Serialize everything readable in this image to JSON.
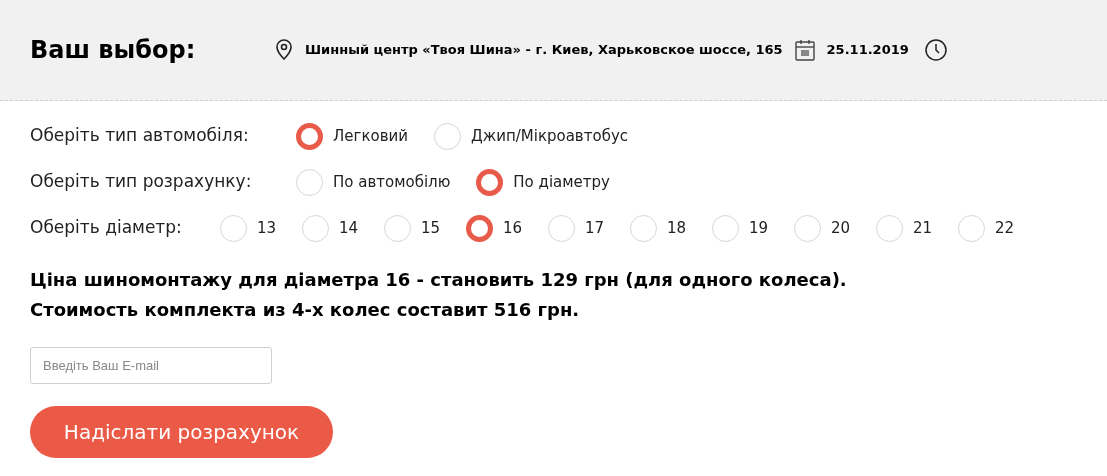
{
  "header": {
    "title": "Ваш выбор:",
    "location": "Шинный центр «Твоя Шина» - г. Киев, Харьковское шоссе, 165",
    "date": "25.11.2019"
  },
  "groups": [
    {
      "label": "Оберіть тип автомобіля:",
      "options": [
        {
          "label": "Легковий",
          "selected": true
        },
        {
          "label": "Джип/Мікроавтобус",
          "selected": false
        }
      ]
    },
    {
      "label": "Оберіть тип розрахунку:",
      "options": [
        {
          "label": "По автомобілю",
          "selected": false
        },
        {
          "label": "По діаметру",
          "selected": true
        }
      ]
    },
    {
      "label": "Оберіть діаметр:",
      "options": [
        {
          "label": "13",
          "selected": false
        },
        {
          "label": "14",
          "selected": false
        },
        {
          "label": "15",
          "selected": false
        },
        {
          "label": "16",
          "selected": true
        },
        {
          "label": "17",
          "selected": false
        },
        {
          "label": "18",
          "selected": false
        },
        {
          "label": "19",
          "selected": false
        },
        {
          "label": "20",
          "selected": false
        },
        {
          "label": "21",
          "selected": false
        },
        {
          "label": "22",
          "selected": false
        }
      ]
    }
  ],
  "result": [
    "Ціна шиномонтажу для діаметра 16 - становить 129 грн (для одного колеса).",
    "Стоимость комплекта из 4-х колес составит 516 грн."
  ],
  "email": {
    "placeholder": "Введіть Ваш E-mail"
  },
  "submit": "Надіслати розрахунок"
}
